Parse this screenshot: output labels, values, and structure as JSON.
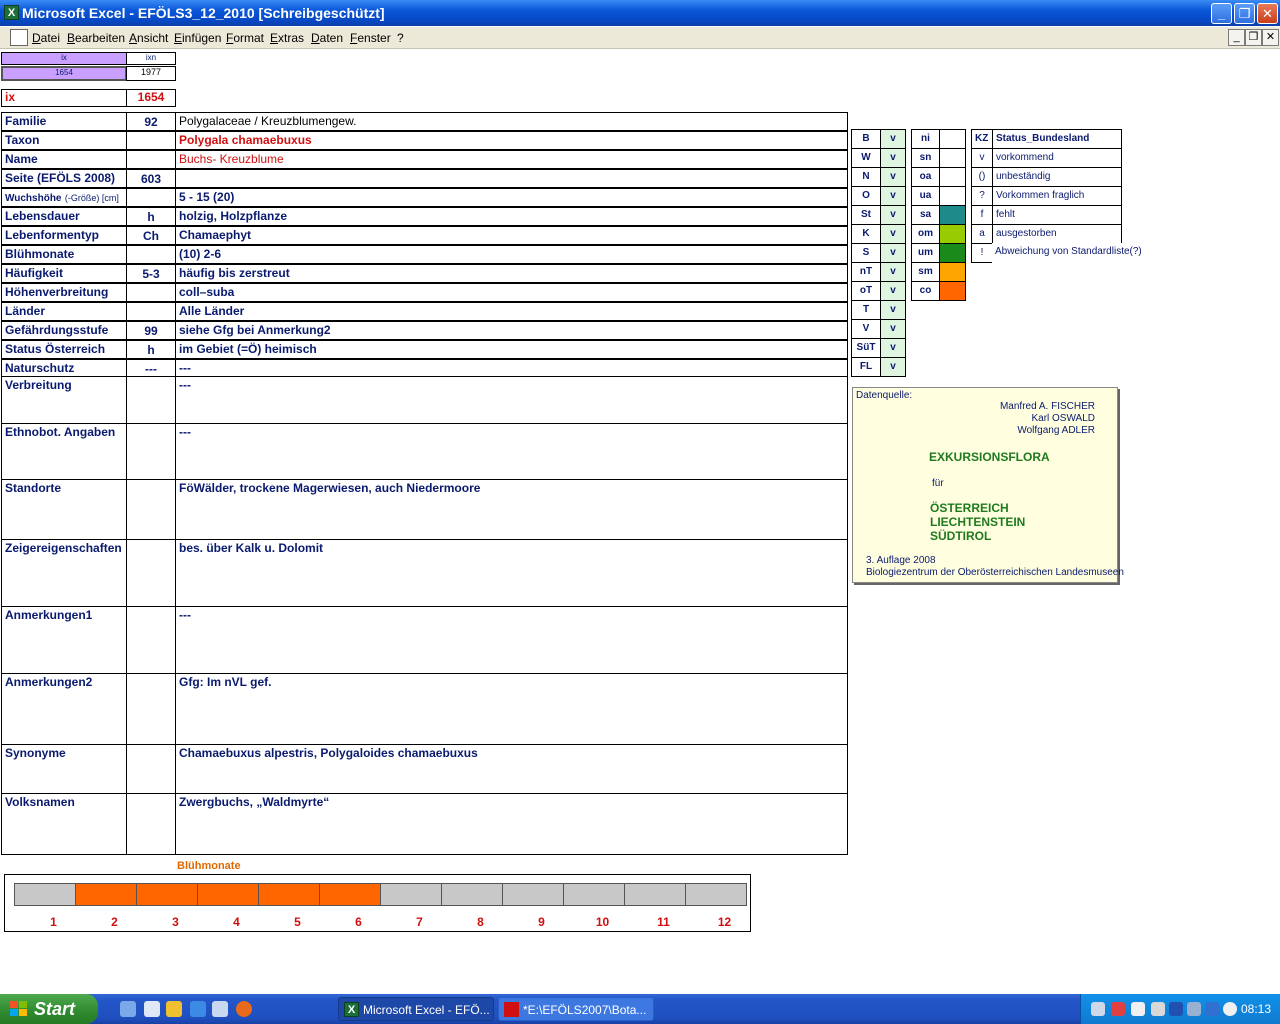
{
  "window": {
    "title": "Microsoft Excel - EFÖLS3_12_2010  [Schreibgeschützt]",
    "app_icon": "excel-icon",
    "minimize": "_",
    "maximize": "❐",
    "close": "✕"
  },
  "menu": {
    "items": [
      "Datei",
      "Bearbeiten",
      "Ansicht",
      "Einfügen",
      "Format",
      "Extras",
      "Daten",
      "Fenster",
      "?"
    ],
    "mdi_minimize": "_",
    "mdi_restore": "❐",
    "mdi_close": "✕"
  },
  "ix_header": {
    "ix_label": "ix",
    "ixn_label": "ixn",
    "ix_value": "1654",
    "ixn_value": "1977"
  },
  "ix_row": {
    "label": "ix",
    "value": "1654"
  },
  "rows": [
    {
      "label": "Familie",
      "code": "92",
      "value": "Polygalaceae  /  Kreuzblumengew."
    },
    {
      "label": "Taxon",
      "code": "",
      "value": "Polygala chamaebuxus"
    },
    {
      "label": "Name",
      "code": "",
      "value": "Buchs- Kreuzblume"
    },
    {
      "label": "Seite (EFÖLS 2008)",
      "code": "603",
      "value": ""
    },
    {
      "label": "Wuchshöhe",
      "label_suffix": "(-Größe) [cm]",
      "code": "",
      "value": " 5 - 15 (20)"
    },
    {
      "label": "Lebensdauer",
      "code": "h",
      "value": "holzig, Holzpflanze"
    },
    {
      "label": "Lebenformentyp",
      "code": "Ch",
      "value": "Chamaephyt"
    },
    {
      "label": "Blühmonate",
      "code": "",
      "value": "(10) 2-6"
    },
    {
      "label": "Häufigkeit",
      "code": "5-3",
      "value": "häufig bis zerstreut"
    },
    {
      "label": "Höhenverbreitung",
      "code": "",
      "value": "coll–suba"
    },
    {
      "label": "Länder",
      "code": "",
      "value": "Alle Länder"
    },
    {
      "label": "Gefährdungsstufe",
      "code": "99",
      "value": "siehe Gfg bei Anmerkung2"
    },
    {
      "label": "Status Österreich",
      "code": "h",
      "value": "im Gebiet (=Ö) heimisch"
    },
    {
      "label": "Naturschutz",
      "code": "---",
      "value": "---"
    }
  ],
  "tall_rows": [
    {
      "label": "Verbreitung",
      "value": "---"
    },
    {
      "label": "Ethnobot. Angaben",
      "value": "---"
    },
    {
      "label": "Standorte",
      "value": "FöWälder, trockene Magerwiesen, auch Niedermoore"
    },
    {
      "label": "Zeigereigenschaften",
      "value": "bes. über Kalk u. Dolomit"
    },
    {
      "label": "Anmerkungen1",
      "value": "---"
    },
    {
      "label": "Anmerkungen2",
      "value": "Gfg: Im nVL gef."
    },
    {
      "label": "Synonyme",
      "value": "Chamaebuxus alpestris, Polygaloides chamaebuxus"
    },
    {
      "label": "Volksnamen",
      "value": "Zwergbuchs, „Waldmyrte“"
    }
  ],
  "states": [
    {
      "code": "B",
      "status": "v"
    },
    {
      "code": "W",
      "status": "v"
    },
    {
      "code": "N",
      "status": "v"
    },
    {
      "code": "O",
      "status": "v"
    },
    {
      "code": "St",
      "status": "v"
    },
    {
      "code": "K",
      "status": "v"
    },
    {
      "code": "S",
      "status": "v"
    },
    {
      "code": "nT",
      "status": "v"
    },
    {
      "code": "oT",
      "status": "v"
    },
    {
      "code": "T",
      "status": "v"
    },
    {
      "code": "V",
      "status": "v"
    },
    {
      "code": "SüT",
      "status": "v"
    },
    {
      "code": "FL",
      "status": "v"
    }
  ],
  "altitude_zones": [
    {
      "code": "ni",
      "color": "#ffffff"
    },
    {
      "code": "sn",
      "color": "#ffffff"
    },
    {
      "code": "oa",
      "color": "#ffffff"
    },
    {
      "code": "ua",
      "color": "#ffffff"
    },
    {
      "code": "sa",
      "color": "#1f8a8a"
    },
    {
      "code": "om",
      "color": "#99cc00"
    },
    {
      "code": "um",
      "color": "#1a8a1a"
    },
    {
      "code": "sm",
      "color": "#ffa500"
    },
    {
      "code": "co",
      "color": "#ff6600"
    }
  ],
  "legend": {
    "kz_header": "KZ",
    "status_header": "Status_Bundesland",
    "items": [
      {
        "kz": "v",
        "text": "vorkommend"
      },
      {
        "kz": "()",
        "text": "unbeständig"
      },
      {
        "kz": "?",
        "text": "Vorkommen fraglich"
      },
      {
        "kz": "f",
        "text": "fehlt"
      },
      {
        "kz": "a",
        "text": "ausgestorben"
      },
      {
        "kz": "!",
        "text": "Abweichung von Standardliste(?)"
      }
    ]
  },
  "source": {
    "label": "Datenquelle:",
    "authors": [
      "Manfred A. FISCHER",
      "Karl OSWALD",
      "Wolfgang ADLER"
    ],
    "title": "EXKURSIONSFLORA",
    "fuer": "für",
    "regions": [
      "ÖSTERREICH",
      "LIECHTENSTEIN",
      "SÜDTIROL"
    ],
    "edition": "3. Auflage 2008",
    "publisher": "Biologiezentrum der Oberösterreichischen Landesmuseen"
  },
  "bluehmonate": {
    "title": "Blühmonate",
    "months": [
      "1",
      "2",
      "3",
      "4",
      "5",
      "6",
      "7",
      "8",
      "9",
      "10",
      "11",
      "12"
    ],
    "flowering": [
      false,
      true,
      true,
      true,
      true,
      true,
      false,
      false,
      false,
      false,
      false,
      false
    ],
    "on_color": "#ff6600",
    "off_color": "#c8c8c8"
  },
  "taskbar": {
    "start": "Start",
    "tasks": [
      {
        "label": "Microsoft Excel - EFÖ...",
        "active": true
      },
      {
        "label": "*E:\\EFÖLS2007\\Bota...",
        "active": false
      }
    ],
    "clock": "08:13"
  }
}
